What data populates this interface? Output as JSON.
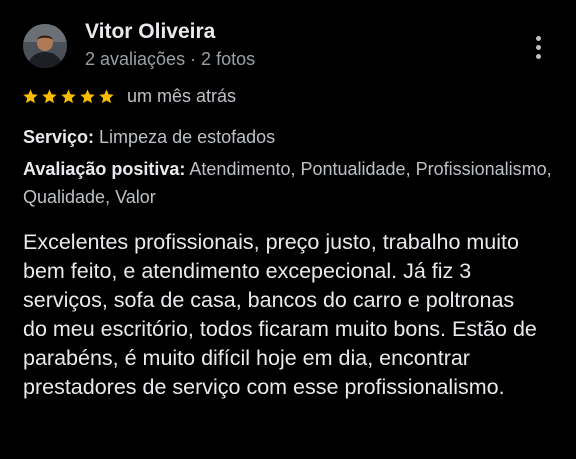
{
  "reviewer": {
    "name": "Vitor Oliveira",
    "meta": "2 avaliações · 2 fotos"
  },
  "rating": {
    "stars": 5,
    "max_stars": 5,
    "star_color": "#fbbc04",
    "date": "um mês atrás"
  },
  "details": {
    "service_label": "Serviço:",
    "service_value": " Limpeza de estofados",
    "positive_label": "Avaliação positiva:",
    "positive_value": " Atendimento, Pontualidade, Profissionalismo, Qualidade, Valor"
  },
  "review_text": "Excelentes profissionais, preço justo, trabalho muito bem feito, e atendimento excepecional. Já fiz 3 serviços, sofa de casa, bancos do carro e poltronas do meu escritório, todos ficaram muito bons. Estão de parabéns, é muito difícil hoje em dia, encontrar prestadores de serviço com esse profissionalismo.",
  "icons": {
    "more": "more-vert-icon",
    "star": "star-icon",
    "avatar": "avatar"
  },
  "colors": {
    "background": "#000000",
    "primary_text": "#e8eaed",
    "secondary_text": "#9aa0a6"
  }
}
